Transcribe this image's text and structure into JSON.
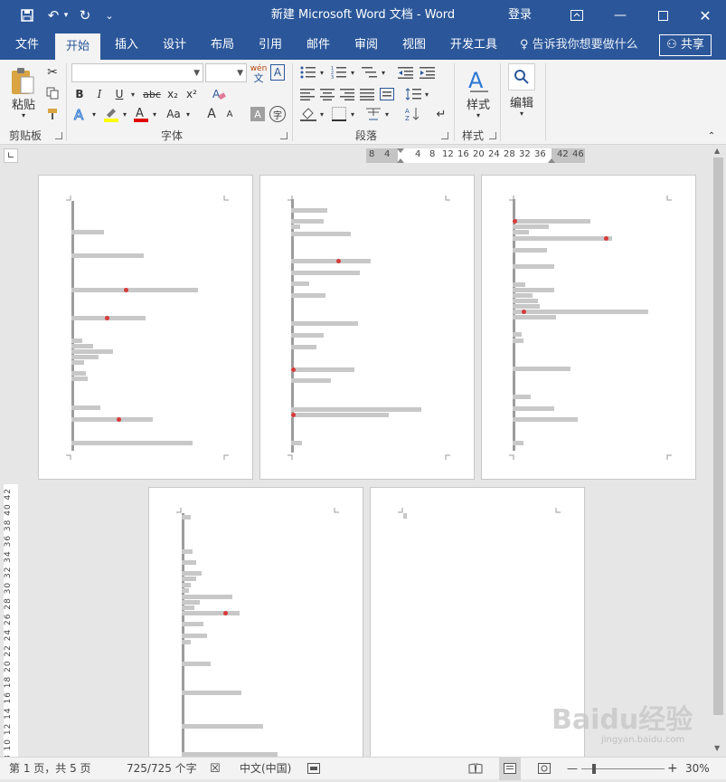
{
  "titlebar": {
    "title": "新建 Microsoft Word 文档  -  Word",
    "login": "登录",
    "save_icon": "save-icon",
    "undo_icon": "undo-icon",
    "redo_icon": "redo-icon",
    "customize_icon": "customize-icon"
  },
  "tabs": [
    "文件",
    "开始",
    "插入",
    "设计",
    "布局",
    "引用",
    "邮件",
    "审阅",
    "视图",
    "开发工具"
  ],
  "active_tab": "开始",
  "tell_me": "告诉我你想要做什么",
  "share": "共享",
  "ribbon": {
    "clipboard": {
      "paste": "粘贴",
      "group": "剪贴板"
    },
    "font": {
      "group": "字体",
      "font_name": "",
      "font_size": "",
      "bold": "B",
      "italic": "I",
      "underline": "U",
      "strike": "abc",
      "subscript": "x₂",
      "superscript": "x²",
      "change_case": "Aa",
      "grow": "A",
      "shrink": "A",
      "wen": "wén",
      "wen_char": "文",
      "border_char": "A",
      "shading_char": "A",
      "enclose_char": "字"
    },
    "paragraph": {
      "group": "段落"
    },
    "styles": {
      "label": "样式",
      "group": "样式"
    },
    "editing": {
      "label": "编辑"
    }
  },
  "ruler": {
    "ticks": [
      "8",
      "4",
      "",
      "4",
      "8",
      "12",
      "16",
      "20",
      "24",
      "28",
      "32",
      "36",
      "",
      "42",
      "46"
    ],
    "vertical": "4 2  2 4 6 8 10 12 14 16 18 20 22 24 26 28 30 32 34 36 38 40 42"
  },
  "status": {
    "page": "第 1 页，共 5 页",
    "words": "725/725 个字",
    "language": "中文(中国)",
    "zoom": "30%"
  },
  "watermark": {
    "text": "Baidu经验",
    "sub": "jingyan.baidu.com"
  },
  "colors": {
    "brand": "#2b579a",
    "highlight": "#ffff00",
    "font_color": "#e00000"
  }
}
